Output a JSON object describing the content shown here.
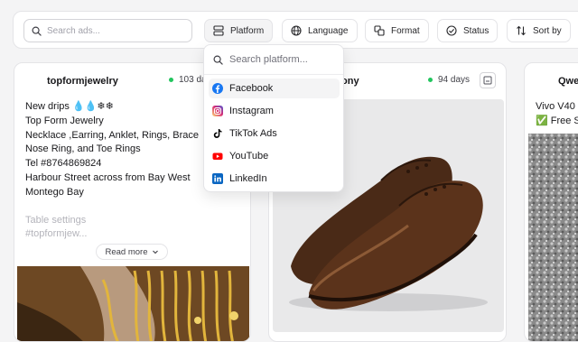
{
  "toolbar": {
    "search_placeholder": "Search ads...",
    "filters": [
      {
        "label": "Platform",
        "icon": "platform-icon"
      },
      {
        "label": "Language",
        "icon": "globe-icon"
      },
      {
        "label": "Format",
        "icon": "format-icon"
      },
      {
        "label": "Status",
        "icon": "status-check-icon"
      },
      {
        "label": "Sort by",
        "icon": "sort-icon"
      }
    ]
  },
  "dropdown": {
    "search_placeholder": "Search platform...",
    "options": [
      {
        "label": "Facebook",
        "icon": "facebook-icon",
        "color": "#1877f2"
      },
      {
        "label": "Instagram",
        "icon": "instagram-icon",
        "color": "#d62976"
      },
      {
        "label": "TikTok Ads",
        "icon": "tiktok-icon",
        "color": "#000000"
      },
      {
        "label": "YouTube",
        "icon": "youtube-icon",
        "color": "#ff0000"
      },
      {
        "label": "LinkedIn",
        "icon": "linkedin-icon",
        "color": "#0a66c2"
      }
    ]
  },
  "cards": [
    {
      "username": "topformjewelry",
      "days": "103 da",
      "lines": [
        "New drips 💧💧❄❄",
        "Top Form Jewelry",
        "Necklace ,Earring, Anklet, Rings, Brace",
        "Nose Ring, and Toe Rings",
        "Tel #8764869824",
        "Harbour Street across from Bay West",
        "Montego Bay"
      ],
      "muted_lines": [
        "Table settings",
        "#topformjew..."
      ],
      "read_more": "Read more"
    },
    {
      "username": "ony",
      "days": "94 days"
    },
    {
      "username": "Qwe",
      "lines": [
        "Vivo V40",
        "✅ Free S"
      ]
    }
  ],
  "colors": {
    "accent_green": "#22c55e",
    "border": "#e4e4e7"
  }
}
